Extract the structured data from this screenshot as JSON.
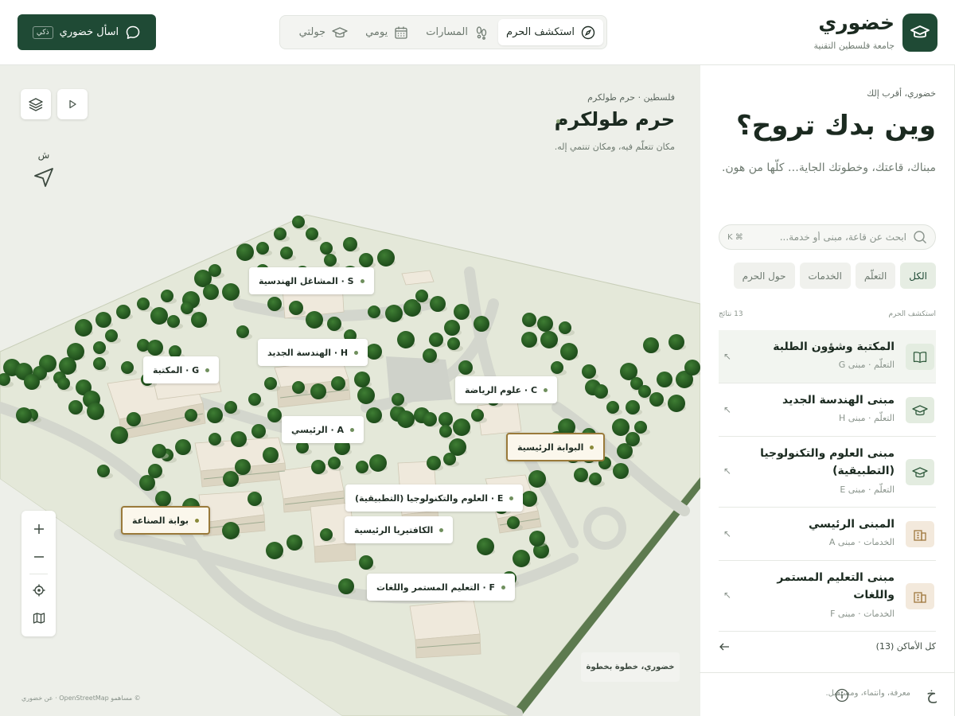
{
  "header": {
    "brand_name": "خضوري",
    "brand_sub": "جامعة فلسطين التقنية",
    "nav": [
      {
        "label": "استكشف الحرم",
        "icon": "compass-icon",
        "active": true
      },
      {
        "label": "المسارات",
        "icon": "footsteps-icon",
        "active": false
      },
      {
        "label": "يومي",
        "icon": "calendar-icon",
        "active": false
      },
      {
        "label": "جولتي",
        "icon": "graduation-cap-icon",
        "active": false
      }
    ],
    "ask_label": "اسأل خضوري",
    "ask_badge": "ذكي"
  },
  "sidebar": {
    "eyebrow": "خضوري، أقرب إلك",
    "title": "وين بدك تروح؟",
    "description": "مبناك، قاعتك، وخطوتك الجاية… كلّها من هون.",
    "search_placeholder": "ابحث عن قاعة، مبنى أو خدمة...",
    "search_kbd": "⌘ K",
    "filters": [
      {
        "label": "الكل",
        "active": true
      },
      {
        "label": "التعلّم",
        "active": false
      },
      {
        "label": "الخدمات",
        "active": false
      },
      {
        "label": "حول الحرم",
        "active": false
      }
    ],
    "results_label": "استكشف الحرم",
    "results_count": "13 نتائج",
    "places": [
      {
        "title": "المكتبة وشؤون الطلبة",
        "meta": "التعلّم · مبنى G",
        "icon": "book-icon",
        "tone": "green",
        "highlight": true,
        "tall": false
      },
      {
        "title": "مبنى الهندسة الجديد",
        "meta": "التعلّم · مبنى H",
        "icon": "graduation-cap-icon",
        "tone": "green",
        "highlight": false,
        "tall": false
      },
      {
        "title": "مبنى العلوم والتكنولوجيا (التطبيقية)",
        "meta": "التعلّم · مبنى E",
        "icon": "graduation-cap-icon",
        "tone": "green",
        "highlight": false,
        "tall": true
      },
      {
        "title": "المبنى الرئيسي",
        "meta": "الخدمات · مبنى A",
        "icon": "building-icon",
        "tone": "beige",
        "highlight": false,
        "tall": false
      },
      {
        "title": "مبنى التعليم المستمر واللغات",
        "meta": "الخدمات · مبنى F",
        "icon": "building-icon",
        "tone": "beige",
        "highlight": false,
        "tall": true
      }
    ],
    "all_places_label": "كل الأماكن (13)",
    "footer_mark": "خ",
    "footer_text": "معرفة، وانتماء، ومستقبل."
  },
  "map": {
    "eyebrow": "فلسطين · حرم طولكرم",
    "title": "حرم طولكرم",
    "tagline": "مكان تتعلّم فيه، ومكان تنتمي إله.",
    "compass_label": "ش",
    "labels": [
      {
        "text": "S · المشاغل الهندسية",
        "kind": "building"
      },
      {
        "text": "H · الهندسة الجديد",
        "kind": "building"
      },
      {
        "text": "G · المكتبة",
        "kind": "building"
      },
      {
        "text": "C · علوم الرياضة",
        "kind": "building"
      },
      {
        "text": "A · الرئيسي",
        "kind": "building"
      },
      {
        "text": "البوابة الرئيسية",
        "kind": "gate"
      },
      {
        "text": "E · العلوم والتكنولوجيا (التطبيقية)",
        "kind": "building"
      },
      {
        "text": "الكافتيريا الرئيسية",
        "kind": "building"
      },
      {
        "text": "بوابة الصناعة",
        "kind": "gate"
      },
      {
        "text": "F · التعليم المستمر واللغات",
        "kind": "building"
      }
    ],
    "chip_text": "خضوري، خطوة بخطوة",
    "attribution": "© مساهمو OpenStreetMap · عن خضوري"
  },
  "colors": {
    "brand": "#1f4a35",
    "tree": "#2f6b2a",
    "ground": "#e6eadb",
    "gate_border": "#9a7a3a"
  }
}
